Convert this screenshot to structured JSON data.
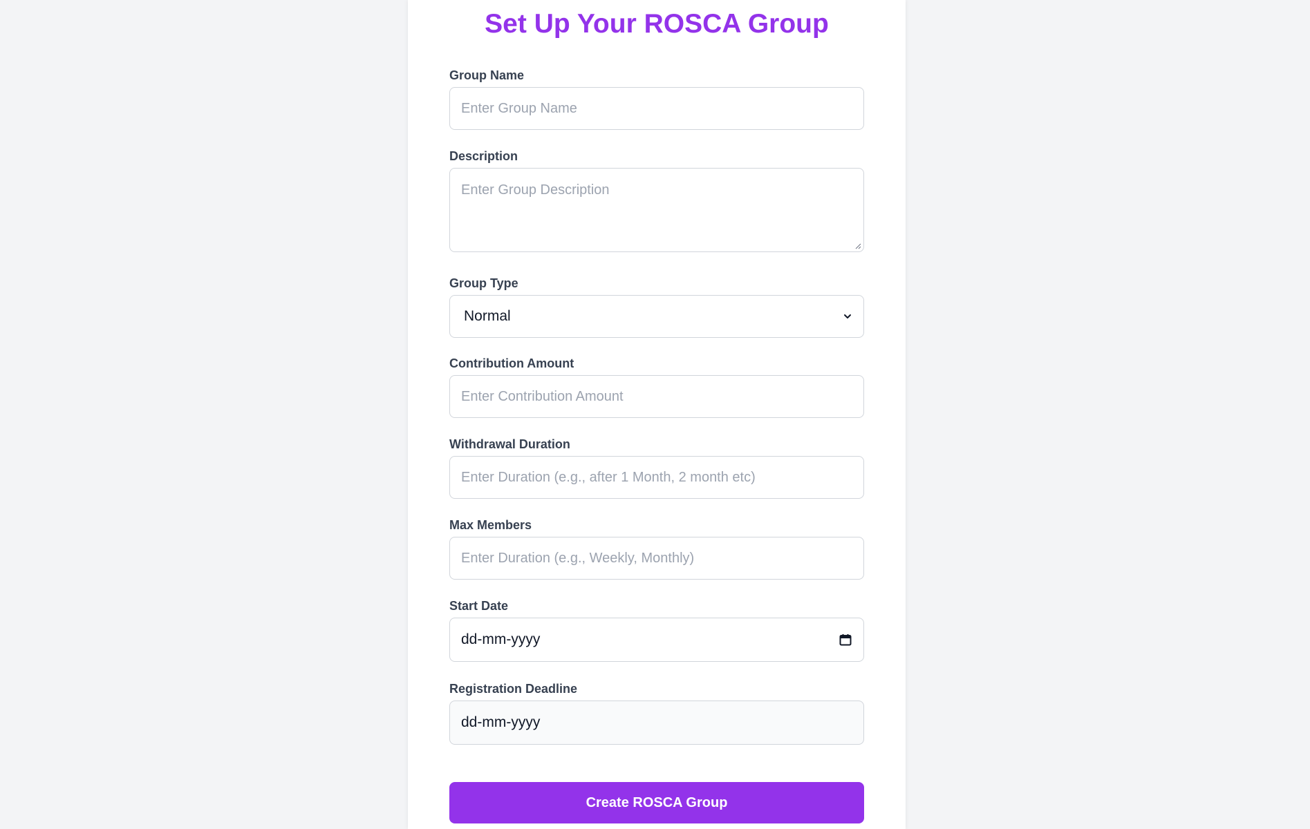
{
  "page": {
    "title": "Set Up Your ROSCA Group"
  },
  "fields": {
    "group_name": {
      "label": "Group Name",
      "placeholder": "Enter Group Name"
    },
    "description": {
      "label": "Description",
      "placeholder": "Enter Group Description"
    },
    "group_type": {
      "label": "Group Type",
      "value": "Normal"
    },
    "contribution_amount": {
      "label": "Contribution Amount",
      "placeholder": "Enter Contribution Amount"
    },
    "withdrawal_duration": {
      "label": "Withdrawal Duration",
      "placeholder": "Enter Duration (e.g., after 1 Month, 2 month etc)"
    },
    "max_members": {
      "label": "Max Members",
      "placeholder": "Enter Duration (e.g., Weekly, Monthly)"
    },
    "start_date": {
      "label": "Start Date",
      "value": "dd-mm-yyyy"
    },
    "registration_deadline": {
      "label": "Registration Deadline",
      "value": "dd-mm-yyyy"
    }
  },
  "actions": {
    "submit_label": "Create ROSCA Group"
  },
  "icons": {
    "select_chevron": "chevron-down-icon",
    "date_picker": "calendar-icon",
    "textarea_resize": "resize-grip-icon"
  },
  "colors": {
    "accent": "#9333ea",
    "background": "#f3f4f6",
    "card": "#ffffff",
    "label": "#374151",
    "placeholder": "#9ca3af",
    "border": "#d1d5db"
  }
}
